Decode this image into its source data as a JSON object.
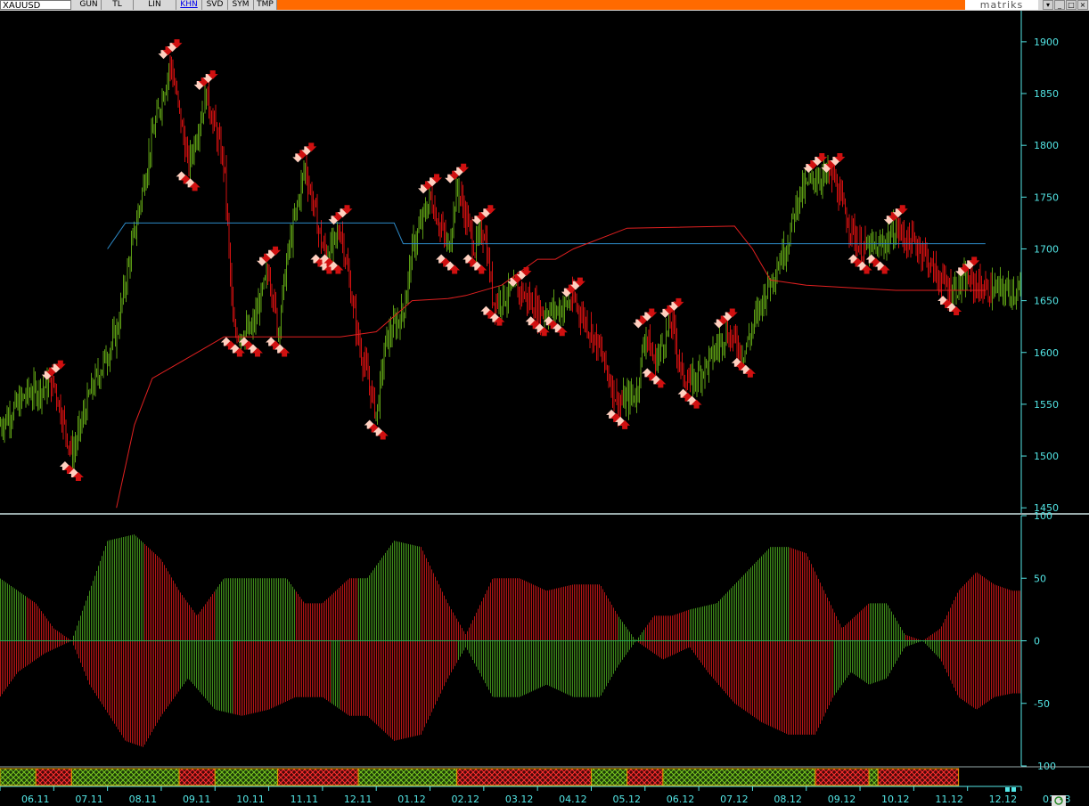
{
  "toolbar": {
    "symbol": "XAUUSD",
    "tabs": [
      "GUN",
      "TL",
      "LIN",
      "KHN",
      "SVD",
      "SYM",
      "TMP"
    ],
    "active_tab": "KHN",
    "brand": "matriks"
  },
  "colors": {
    "bull": "#5c9c14",
    "bear": "#d01010",
    "axis": "#53e6e6",
    "signal_up": "#ffd0c0",
    "channel_upper": "#2d8ac8",
    "channel_lower": "#e02020"
  },
  "chart_data": [
    {
      "type": "line",
      "y_ticks": [
        1450,
        1500,
        1550,
        1600,
        1650,
        1700,
        1750,
        1800,
        1850,
        1900
      ],
      "ylim": [
        1445,
        1930
      ],
      "x_labels": [
        "06.11",
        "07.11",
        "08.11",
        "09.11",
        "10.11",
        "11.11",
        "12.11",
        "01.12",
        "02.12",
        "03.12",
        "04.12",
        "05.12",
        "06.12",
        "07.12",
        "08.12",
        "09.12",
        "10.12",
        "11.12",
        "12.12",
        "01.13"
      ],
      "price_anchors": [
        [
          0,
          1530
        ],
        [
          3,
          1560
        ],
        [
          6,
          1570
        ],
        [
          8,
          1500
        ],
        [
          10,
          1560
        ],
        [
          13,
          1620
        ],
        [
          14,
          1670
        ],
        [
          17,
          1810
        ],
        [
          19,
          1880
        ],
        [
          21,
          1780
        ],
        [
          23,
          1850
        ],
        [
          25,
          1780
        ],
        [
          26,
          1620
        ],
        [
          28,
          1620
        ],
        [
          30,
          1680
        ],
        [
          31,
          1620
        ],
        [
          32,
          1690
        ],
        [
          34,
          1780
        ],
        [
          36,
          1700
        ],
        [
          37,
          1700
        ],
        [
          38,
          1720
        ],
        [
          40,
          1610
        ],
        [
          42,
          1540
        ],
        [
          43,
          1610
        ],
        [
          45,
          1640
        ],
        [
          46,
          1700
        ],
        [
          48,
          1750
        ],
        [
          50,
          1700
        ],
        [
          51,
          1760
        ],
        [
          53,
          1700
        ],
        [
          54,
          1720
        ],
        [
          55,
          1650
        ],
        [
          58,
          1660
        ],
        [
          60,
          1640
        ],
        [
          62,
          1640
        ],
        [
          64,
          1650
        ],
        [
          66,
          1620
        ],
        [
          67,
          1600
        ],
        [
          69,
          1550
        ],
        [
          71,
          1560
        ],
        [
          72,
          1620
        ],
        [
          73,
          1590
        ],
        [
          75,
          1630
        ],
        [
          76,
          1580
        ],
        [
          77,
          1570
        ],
        [
          79,
          1590
        ],
        [
          81,
          1620
        ],
        [
          83,
          1600
        ],
        [
          85,
          1650
        ],
        [
          86,
          1670
        ],
        [
          88,
          1710
        ],
        [
          89,
          1750
        ],
        [
          91,
          1770
        ],
        [
          93,
          1770
        ],
        [
          94,
          1740
        ],
        [
          96,
          1700
        ],
        [
          98,
          1700
        ],
        [
          100,
          1720
        ],
        [
          101,
          1710
        ],
        [
          103,
          1700
        ],
        [
          104,
          1680
        ],
        [
          106,
          1660
        ],
        [
          108,
          1670
        ],
        [
          110,
          1660
        ]
      ],
      "upper_channel": [
        [
          12,
          1700
        ],
        [
          14,
          1725
        ],
        [
          44,
          1725
        ],
        [
          45,
          1705
        ],
        [
          110,
          1705
        ]
      ],
      "lower_channel": [
        [
          13,
          1450
        ],
        [
          15,
          1530
        ],
        [
          17,
          1575
        ],
        [
          20,
          1590
        ],
        [
          22,
          1600
        ],
        [
          25,
          1615
        ],
        [
          38,
          1615
        ],
        [
          42,
          1620
        ],
        [
          46,
          1650
        ],
        [
          50,
          1652
        ],
        [
          52,
          1655
        ],
        [
          56,
          1665
        ],
        [
          60,
          1690
        ],
        [
          62,
          1690
        ],
        [
          64,
          1700
        ],
        [
          70,
          1720
        ],
        [
          82,
          1722
        ],
        [
          84,
          1700
        ],
        [
          86,
          1670
        ],
        [
          90,
          1665
        ],
        [
          100,
          1660
        ],
        [
          110,
          1660
        ]
      ]
    },
    {
      "type": "bar",
      "y_ticks": [
        100,
        50,
        0,
        -50,
        -100
      ],
      "ylim": [
        -100,
        100
      ],
      "pos_anchors": [
        [
          0,
          50
        ],
        [
          4,
          30
        ],
        [
          6,
          10
        ],
        [
          8,
          0
        ],
        [
          12,
          80
        ],
        [
          15,
          85
        ],
        [
          18,
          65
        ],
        [
          20,
          40
        ],
        [
          22,
          20
        ],
        [
          25,
          50
        ],
        [
          28,
          50
        ],
        [
          32,
          50
        ],
        [
          34,
          30
        ],
        [
          36,
          30
        ],
        [
          39,
          50
        ],
        [
          41,
          50
        ],
        [
          44,
          80
        ],
        [
          47,
          75
        ],
        [
          50,
          30
        ],
        [
          52,
          5
        ],
        [
          55,
          50
        ],
        [
          58,
          50
        ],
        [
          61,
          40
        ],
        [
          64,
          45
        ],
        [
          67,
          45
        ],
        [
          69,
          20
        ],
        [
          71,
          0
        ],
        [
          73,
          20
        ],
        [
          75,
          20
        ],
        [
          77,
          25
        ],
        [
          80,
          30
        ],
        [
          82,
          45
        ],
        [
          84,
          60
        ],
        [
          86,
          75
        ],
        [
          88,
          75
        ],
        [
          90,
          70
        ],
        [
          92,
          40
        ],
        [
          94,
          10
        ],
        [
          97,
          30
        ],
        [
          99,
          30
        ],
        [
          101,
          5
        ],
        [
          103,
          0
        ],
        [
          105,
          10
        ],
        [
          107,
          40
        ],
        [
          109,
          55
        ],
        [
          111,
          45
        ],
        [
          113,
          40
        ]
      ],
      "neg_anchors": [
        [
          0,
          -45
        ],
        [
          2,
          -25
        ],
        [
          5,
          -10
        ],
        [
          8,
          0
        ],
        [
          10,
          -35
        ],
        [
          14,
          -80
        ],
        [
          16,
          -85
        ],
        [
          18,
          -60
        ],
        [
          21,
          -30
        ],
        [
          24,
          -55
        ],
        [
          27,
          -60
        ],
        [
          30,
          -55
        ],
        [
          33,
          -45
        ],
        [
          36,
          -45
        ],
        [
          39,
          -60
        ],
        [
          41,
          -60
        ],
        [
          44,
          -80
        ],
        [
          47,
          -75
        ],
        [
          50,
          -30
        ],
        [
          52,
          -5
        ],
        [
          55,
          -45
        ],
        [
          58,
          -45
        ],
        [
          61,
          -35
        ],
        [
          64,
          -45
        ],
        [
          67,
          -45
        ],
        [
          69,
          -20
        ],
        [
          71,
          0
        ],
        [
          74,
          -15
        ],
        [
          77,
          -5
        ],
        [
          79,
          -25
        ],
        [
          82,
          -50
        ],
        [
          85,
          -65
        ],
        [
          88,
          -75
        ],
        [
          91,
          -75
        ],
        [
          93,
          -45
        ],
        [
          95,
          -25
        ],
        [
          97,
          -35
        ],
        [
          99,
          -30
        ],
        [
          101,
          -5
        ],
        [
          103,
          0
        ],
        [
          105,
          -15
        ],
        [
          107,
          -45
        ],
        [
          109,
          -55
        ],
        [
          111,
          -45
        ],
        [
          113,
          -42
        ]
      ],
      "pos_bull_ranges": [
        [
          0,
          3
        ],
        [
          8,
          16
        ],
        [
          24,
          33
        ],
        [
          40,
          47
        ],
        [
          69,
          72
        ],
        [
          77,
          88
        ],
        [
          97,
          101
        ]
      ],
      "neg_bull_ranges": [
        [
          20,
          26
        ],
        [
          37,
          38
        ],
        [
          51,
          71
        ],
        [
          93,
          105
        ]
      ]
    }
  ],
  "regime_strip": [
    {
      "start": 0,
      "end": 4,
      "state": "bull"
    },
    {
      "start": 4,
      "end": 8,
      "state": "bear"
    },
    {
      "start": 8,
      "end": 20,
      "state": "bull"
    },
    {
      "start": 20,
      "end": 24,
      "state": "bear"
    },
    {
      "start": 24,
      "end": 31,
      "state": "bull"
    },
    {
      "start": 31,
      "end": 40,
      "state": "bear"
    },
    {
      "start": 40,
      "end": 51,
      "state": "bull"
    },
    {
      "start": 51,
      "end": 66,
      "state": "bear"
    },
    {
      "start": 66,
      "end": 70,
      "state": "bull"
    },
    {
      "start": 70,
      "end": 74,
      "state": "bear"
    },
    {
      "start": 74,
      "end": 91,
      "state": "bull"
    },
    {
      "start": 91,
      "end": 97,
      "state": "bear"
    },
    {
      "start": 97,
      "end": 98,
      "state": "bull"
    },
    {
      "start": 98,
      "end": 107,
      "state": "bear"
    }
  ]
}
